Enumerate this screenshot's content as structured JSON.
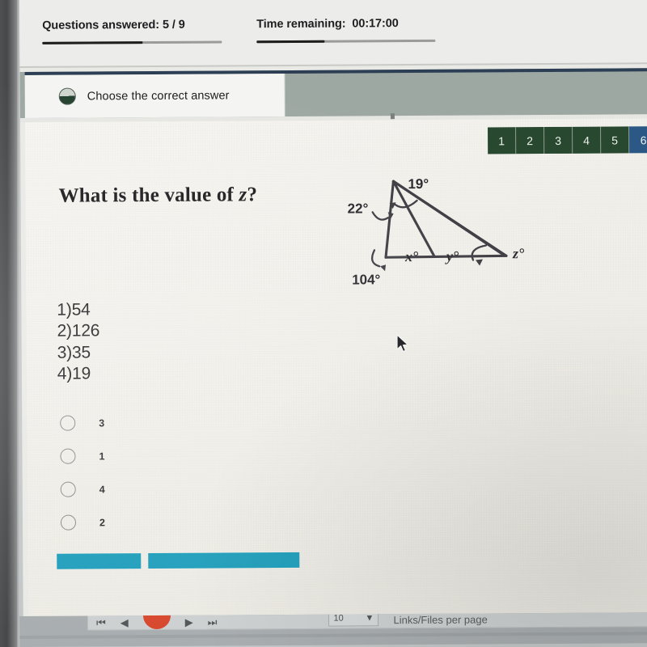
{
  "status": {
    "questions_label": "Questions answered:",
    "questions_value": "5 / 9",
    "questions_progress_pct": 56,
    "time_label": "Time remaining:",
    "time_value": "00:17:00",
    "time_progress_pct": 38
  },
  "tab": {
    "label": "Choose the correct answer",
    "icon": "half-filled-circle-icon"
  },
  "question_nav": {
    "buttons": [
      "1",
      "2",
      "3",
      "4",
      "5",
      "6"
    ],
    "current": "6",
    "color_done": "#28482f",
    "color_current": "#2b5885"
  },
  "question": {
    "prompt_prefix": "What is the value of ",
    "prompt_variable": "z",
    "prompt_suffix": "?",
    "answer_list": [
      "1)54",
      "2)126",
      "3)35",
      "4)19"
    ]
  },
  "figure": {
    "labels": {
      "a22": "22°",
      "a19": "19°",
      "a104": "104°",
      "ax": "x°",
      "ay": "y°",
      "az": "z°"
    }
  },
  "choices": [
    {
      "label": "3",
      "selected": false
    },
    {
      "label": "1",
      "selected": false
    },
    {
      "label": "4",
      "selected": false
    },
    {
      "label": "2",
      "selected": false
    }
  ],
  "actions": {
    "prev_label": "",
    "next_label": "",
    "color": "#1f9ebb"
  },
  "bottom_toolbar": {
    "first_arrow": "⏮",
    "prev_arrow": "◀",
    "next_arrow": "▶",
    "last_arrow": "⏭",
    "per_page_value": "10",
    "per_page_caret": "▼",
    "per_page_label": "Links/Files per page"
  }
}
